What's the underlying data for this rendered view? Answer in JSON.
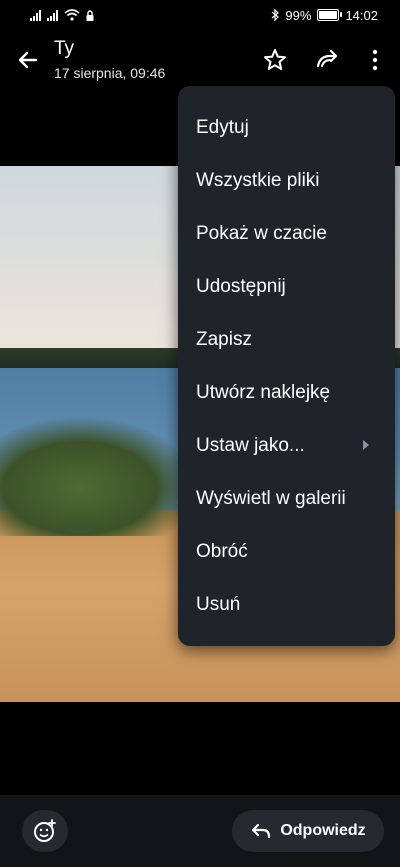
{
  "status_bar": {
    "battery_percent": "99%",
    "time": "14:02"
  },
  "header": {
    "title": "Ty",
    "subtitle": "17 sierpnia, 09:46"
  },
  "menu": {
    "items": [
      {
        "label": "Edytuj"
      },
      {
        "label": "Wszystkie pliki"
      },
      {
        "label": "Pokaż w czacie"
      },
      {
        "label": "Udostępnij"
      },
      {
        "label": "Zapisz"
      },
      {
        "label": "Utwórz naklejkę"
      },
      {
        "label": "Ustaw jako..."
      },
      {
        "label": "Wyświetl w galerii"
      },
      {
        "label": "Obróć"
      },
      {
        "label": "Usuń"
      }
    ]
  },
  "bottom_bar": {
    "reply_label": "Odpowiedz"
  },
  "icons": {
    "back": "arrow-left-icon",
    "star": "star-icon",
    "forward": "forward-icon",
    "more": "more-vertical-icon",
    "sticker": "add-sticker-icon",
    "reply": "reply-icon"
  },
  "colors": {
    "menu_bg": "#1f242a",
    "bottom_bar_bg": "#121417",
    "button_bg": "#252a30"
  }
}
